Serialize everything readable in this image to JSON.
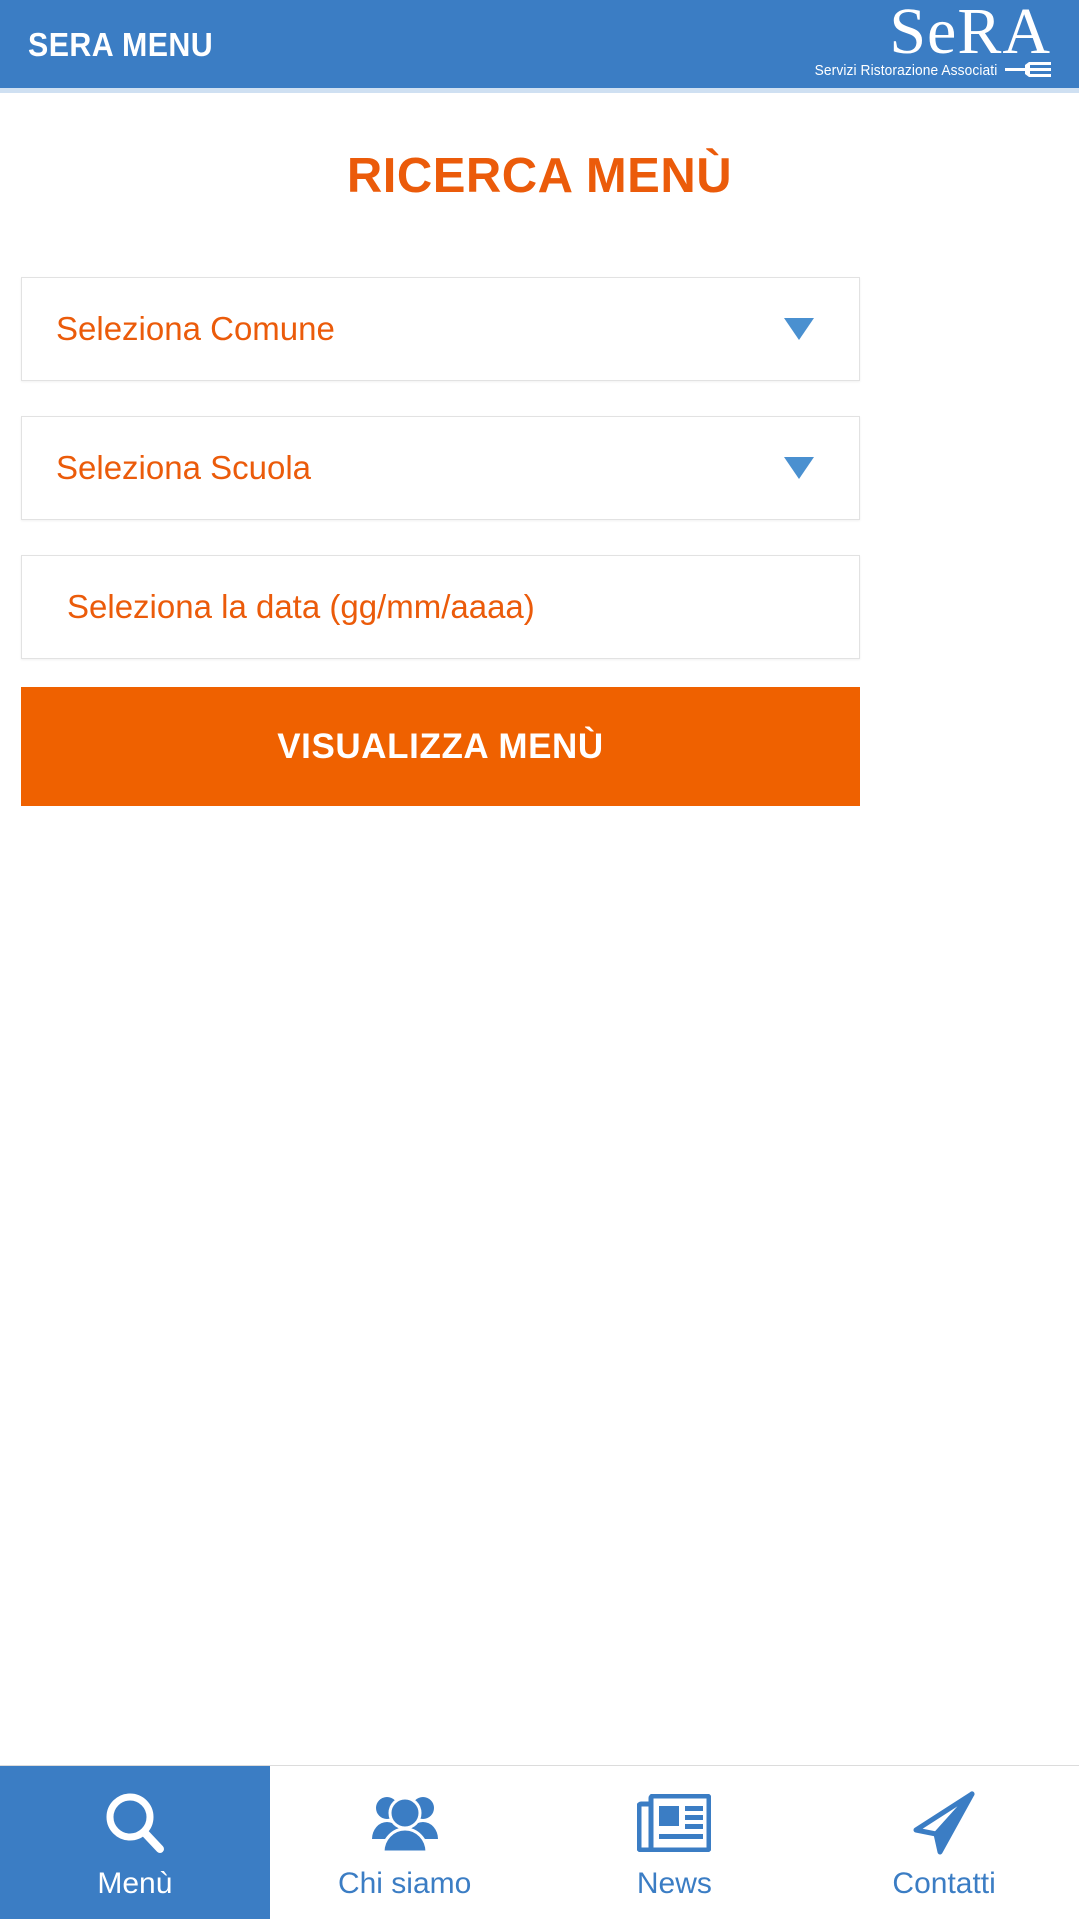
{
  "header": {
    "app_title": "SERA MENU",
    "brand_wordmark": "SeRA",
    "brand_tagline": "Servizi Ristorazione Associati",
    "brand_icon": "fork-icon",
    "background_color": "#3b7dc4"
  },
  "page": {
    "title": "RICERCA MENÙ",
    "title_color": "#eb5b0a"
  },
  "form": {
    "fields": [
      {
        "name": "comune",
        "type": "select",
        "value": "",
        "placeholder": "Seleziona Comune",
        "icon": "chevron-down-icon"
      },
      {
        "name": "scuola",
        "type": "select",
        "value": "",
        "placeholder": "Seleziona Scuola",
        "icon": "chevron-down-icon"
      },
      {
        "name": "data",
        "type": "date",
        "value": "",
        "placeholder": "Seleziona la data (gg/mm/aaaa)",
        "icon": ""
      }
    ],
    "submit_label": "VISUALIZZA MENÙ",
    "submit_color": "#ef6100"
  },
  "bottom_nav": {
    "active_index": 0,
    "accent_color": "#3b7dc4",
    "items": [
      {
        "label": "Menù",
        "icon": "search-icon"
      },
      {
        "label": "Chi siamo",
        "icon": "people-icon"
      },
      {
        "label": "News",
        "icon": "newspaper-icon"
      },
      {
        "label": "Contatti",
        "icon": "paper-plane-icon"
      }
    ]
  }
}
